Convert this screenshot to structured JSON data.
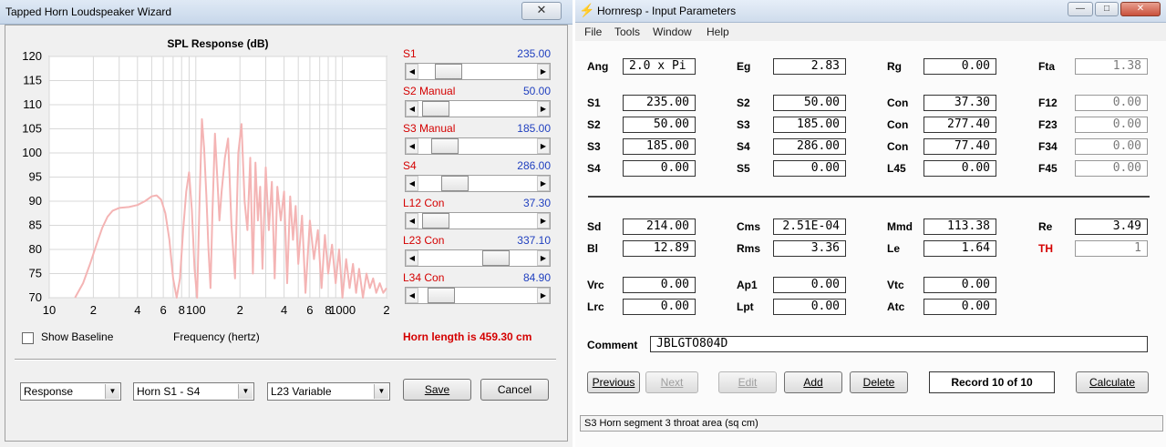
{
  "wizard": {
    "title": "Tapped Horn Loudspeaker Wizard",
    "close_glyph": "✕",
    "chart_title": "SPL Response (dB)",
    "x_axis_label": "Frequency (hertz)",
    "show_baseline_label": "Show Baseline",
    "horn_length": "Horn length is 459.30 cm",
    "sliders": [
      {
        "label": "S1",
        "value": "235.00",
        "position": 0.18
      },
      {
        "label": "S2 Manual",
        "value": "50.00",
        "position": 0.04
      },
      {
        "label": "S3 Manual",
        "value": "185.00",
        "position": 0.14
      },
      {
        "label": "S4",
        "value": "286.00",
        "position": 0.25
      },
      {
        "label": "L12 Con",
        "value": "37.30",
        "position": 0.04
      },
      {
        "label": "L23 Con",
        "value": "337.10",
        "position": 0.7
      },
      {
        "label": "L34 Con",
        "value": "84.90",
        "position": 0.1
      }
    ],
    "combos": [
      {
        "value": "Response"
      },
      {
        "value": "Horn S1 - S4"
      },
      {
        "value": "L23 Variable"
      }
    ],
    "save_label": "Save",
    "cancel_label": "Cancel",
    "colors": {
      "curve": "#f4b4b4",
      "label_red": "#d40000",
      "value_blue": "#1f3fbf"
    }
  },
  "chart_data": {
    "type": "line",
    "title": "SPL Response (dB)",
    "xlabel": "Frequency (hertz)",
    "ylabel": "",
    "x_scale": "log",
    "xlim": [
      10,
      2000
    ],
    "ylim": [
      70,
      120
    ],
    "y_ticks": [
      "120",
      "115",
      "110",
      "105",
      "100",
      "95",
      "90",
      "85",
      "80",
      "75",
      "70"
    ],
    "x_ticks": [
      {
        "label": "10",
        "value": 10
      },
      {
        "label": "2",
        "value": 20
      },
      {
        "label": "4",
        "value": 40
      },
      {
        "label": "6",
        "value": 60
      },
      {
        "label": "8",
        "value": 80
      },
      {
        "label": "100",
        "value": 100
      },
      {
        "label": "2",
        "value": 200
      },
      {
        "label": "4",
        "value": 400
      },
      {
        "label": "6",
        "value": 600
      },
      {
        "label": "8",
        "value": 800
      },
      {
        "label": "1000",
        "value": 1000
      },
      {
        "label": "2",
        "value": 2000
      }
    ],
    "grid": true,
    "series": [
      {
        "x": [
          15,
          17,
          19,
          21,
          23,
          25,
          27,
          30,
          35,
          40,
          45,
          50,
          54,
          58,
          62,
          66,
          70,
          74,
          78,
          82,
          86,
          90,
          94,
          98,
          102,
          106,
          110,
          114,
          118,
          122,
          126,
          130,
          135,
          140,
          145,
          150,
          158,
          166,
          175,
          185,
          195,
          205,
          215,
          225,
          235,
          245,
          255,
          265,
          275,
          285,
          300,
          315,
          330,
          345,
          360,
          380,
          400,
          420,
          440,
          460,
          480,
          500,
          530,
          560,
          600,
          640,
          680,
          720,
          760,
          800,
          850,
          900,
          950,
          1000,
          1060,
          1120,
          1180,
          1240,
          1300,
          1380,
          1460,
          1540,
          1620,
          1700,
          1800,
          1900,
          2000
        ],
        "y": [
          70,
          73,
          77,
          81,
          84.5,
          86.8,
          88,
          88.6,
          88.8,
          89.2,
          90,
          91,
          91.2,
          90.3,
          87.5,
          82,
          74,
          70,
          74,
          84,
          92,
          96,
          88,
          76,
          70,
          90,
          107,
          101,
          91,
          80,
          72,
          88,
          104,
          95,
          86,
          92,
          99,
          103,
          85,
          74,
          100,
          106,
          90,
          84,
          99,
          75,
          98,
          86,
          93,
          76,
          97,
          84,
          94,
          74,
          93,
          86,
          92,
          73,
          91,
          82,
          89,
          77,
          87,
          71,
          86,
          78,
          84,
          72,
          83,
          75,
          81,
          73,
          80,
          70,
          78,
          72,
          77,
          71,
          76,
          70,
          75,
          72,
          74,
          71,
          73,
          71,
          72
        ]
      }
    ]
  },
  "hornresp": {
    "title": "Hornresp - Input Parameters",
    "menus": [
      "File",
      "Tools",
      "Window",
      "Help"
    ],
    "win_buttons": [
      "—",
      "□",
      "✕"
    ],
    "fields": [
      {
        "label": "Ang",
        "value": "2.0 x Pi",
        "style": "left"
      },
      {
        "label": "Eg",
        "value": "2.83"
      },
      {
        "label": "Rg",
        "value": "0.00"
      },
      {
        "label": "Fta",
        "value": "1.38",
        "ro": true
      },
      {
        "label": "S1",
        "value": "235.00"
      },
      {
        "label": "S2",
        "value": "50.00"
      },
      {
        "label": "Con",
        "value": "37.30"
      },
      {
        "label": "F12",
        "value": "0.00",
        "ro": true
      },
      {
        "label": "S2",
        "value": "50.00"
      },
      {
        "label": "S3",
        "value": "185.00"
      },
      {
        "label": "Con",
        "value": "277.40"
      },
      {
        "label": "F23",
        "value": "0.00",
        "ro": true
      },
      {
        "label": "S3",
        "value": "185.00"
      },
      {
        "label": "S4",
        "value": "286.00"
      },
      {
        "label": "Con",
        "value": "77.40"
      },
      {
        "label": "F34",
        "value": "0.00",
        "ro": true
      },
      {
        "label": "S4",
        "value": "0.00"
      },
      {
        "label": "S5",
        "value": "0.00"
      },
      {
        "label": "L45",
        "value": "0.00"
      },
      {
        "label": "F45",
        "value": "0.00",
        "ro": true
      },
      {
        "label": "Sd",
        "value": "214.00"
      },
      {
        "label": "Cms",
        "value": "2.51E-04"
      },
      {
        "label": "Mmd",
        "value": "113.38"
      },
      {
        "label": "Re",
        "value": "3.49"
      },
      {
        "label": "Bl",
        "value": "12.89"
      },
      {
        "label": "Rms",
        "value": "3.36"
      },
      {
        "label": "Le",
        "value": "1.64"
      },
      {
        "label": "TH",
        "value": "1",
        "red": true,
        "ro": true
      },
      {
        "label": "Vrc",
        "value": "0.00"
      },
      {
        "label": "Ap1",
        "value": "0.00"
      },
      {
        "label": "Vtc",
        "value": "0.00"
      },
      {
        "label": "Lrc",
        "value": "0.00"
      },
      {
        "label": "Lpt",
        "value": "0.00"
      },
      {
        "label": "Atc",
        "value": "0.00"
      }
    ],
    "comment_label": "Comment",
    "comment_value": "JBLGTO804D",
    "buttons": {
      "previous": "Previous",
      "next": "Next",
      "edit": "Edit",
      "add": "Add",
      "delete": "Delete",
      "record": "Record 10 of 10",
      "calculate": "Calculate"
    },
    "status": "S3   Horn segment 3 throat area  (sq cm)"
  }
}
